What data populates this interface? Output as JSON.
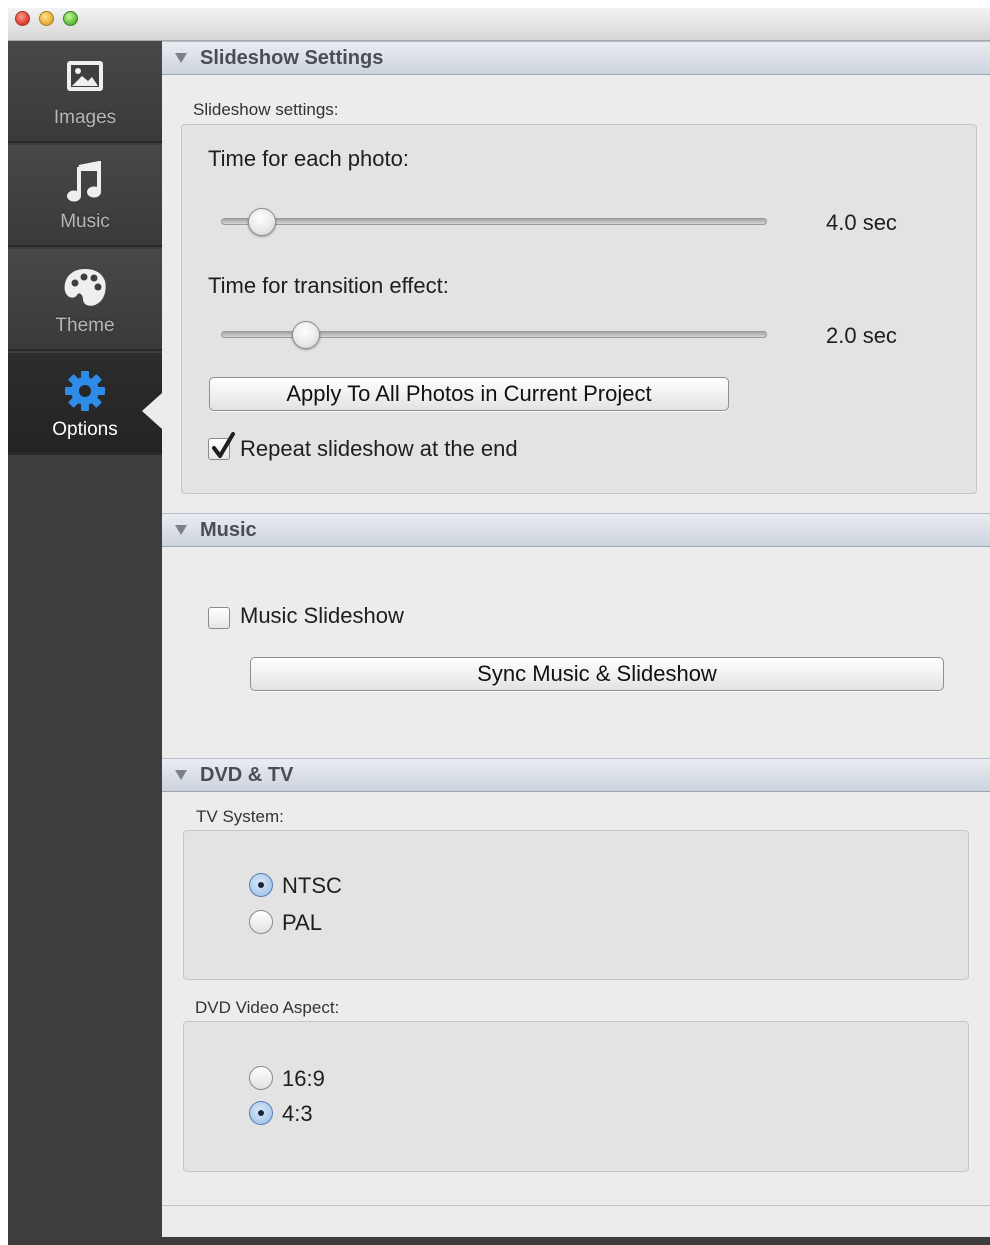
{
  "window": {
    "traffic_lights": [
      "close",
      "minimize",
      "zoom"
    ]
  },
  "sidebar": {
    "items": [
      {
        "label": "Images",
        "icon": "image-icon",
        "active": false
      },
      {
        "label": "Music",
        "icon": "music-note-icon",
        "active": false
      },
      {
        "label": "Theme",
        "icon": "palette-icon",
        "active": false
      },
      {
        "label": "Options",
        "icon": "gear-icon",
        "active": true
      }
    ]
  },
  "slideshow": {
    "header": "Slideshow Settings",
    "group_label": "Slideshow settings:",
    "photo_time_label": "Time for each photo:",
    "photo_time_value": "4.0 sec",
    "photo_time_fraction": 0.05,
    "transition_label": "Time for transition effect:",
    "transition_value": "2.0 sec",
    "transition_fraction": 0.13,
    "apply_button": "Apply To All Photos in Current Project",
    "repeat_label": "Repeat slideshow at the end",
    "repeat_checked": true
  },
  "music": {
    "header": "Music",
    "music_slideshow_label": "Music Slideshow",
    "music_slideshow_checked": false,
    "sync_button": "Sync Music & Slideshow"
  },
  "dvd": {
    "header": "DVD & TV",
    "tv_system_label": "TV System:",
    "tv_options": [
      "NTSC",
      "PAL"
    ],
    "tv_selected": "NTSC",
    "aspect_label": "DVD Video Aspect:",
    "aspect_options": [
      "16:9",
      "4:3"
    ],
    "aspect_selected": "4:3"
  },
  "colors": {
    "sidebar_bg": "#3e3e3e",
    "accent_blue": "#2e8be6",
    "panel_bg": "#ececec"
  }
}
